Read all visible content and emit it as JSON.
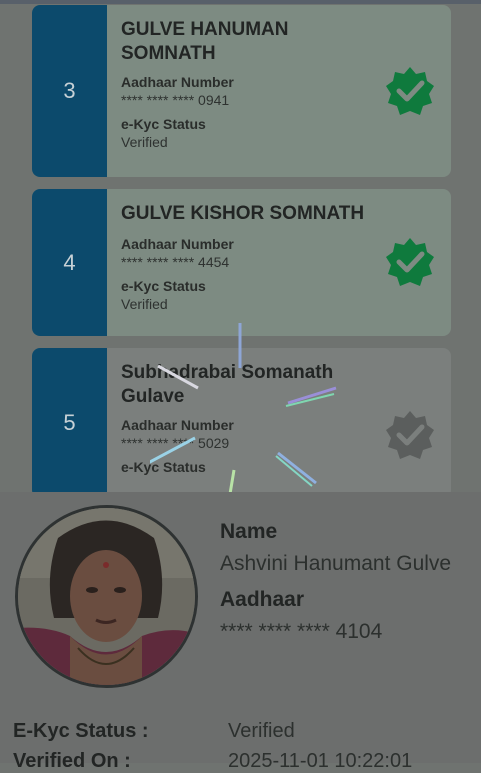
{
  "cards": [
    {
      "number": "3",
      "name": "GULVE HANUMAN SOMNATH",
      "aadhaar_label": "Aadhaar Number",
      "aadhaar_value": "**** **** **** 0941",
      "ekyc_label": "e-Kyc Status",
      "ekyc_value": "Verified",
      "badge": "verified-badge-icon",
      "badge_color": "#0f7a3d"
    },
    {
      "number": "4",
      "name": "GULVE KISHOR SOMNATH",
      "aadhaar_label": "Aadhaar Number",
      "aadhaar_value": "**** **** **** 4454",
      "ekyc_label": "e-Kyc Status",
      "ekyc_value": "Verified",
      "badge": "verified-badge-icon",
      "badge_color": "#0f7a3d"
    },
    {
      "number": "5",
      "name": "Subhadrabai Somanath Gulave",
      "aadhaar_label": "Aadhaar Number",
      "aadhaar_value": "**** **** **** 5029",
      "ekyc_label": "e-Kyc Status",
      "badge": "unverified-badge-icon",
      "badge_color": "#5b5e5d"
    }
  ],
  "detail": {
    "name_label": "Name",
    "name_value": "Ashvini Hanumant Gulve",
    "aadhaar_label": "Aadhaar",
    "aadhaar_value": "**** **** **** 4104",
    "ekyc_label": "E-Kyc Status :",
    "ekyc_value": "Verified",
    "verified_on_label": "Verified On :",
    "verified_on_value": "2025-11-01 10:22:01"
  },
  "loading_indicator": "spinner-icon",
  "colors": {
    "card_number_bg": "#0c4a6c",
    "overlay": "#6f7370"
  }
}
